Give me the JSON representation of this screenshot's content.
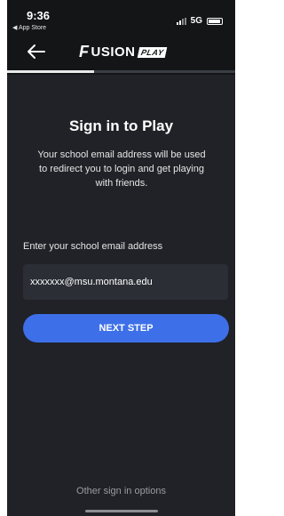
{
  "status_bar": {
    "time": "9:36",
    "back_app": "◀ App Store",
    "network": "5G"
  },
  "nav": {
    "back_icon": "arrow-left-icon",
    "logo_text": "USION",
    "logo_mark": "F",
    "logo_badge": "PLAY",
    "progress": 0.38
  },
  "main": {
    "title": "Sign in to Play",
    "description": "Your school email address will be used to redirect you to login and get playing with friends.",
    "field_label": "Enter your school email address",
    "email_value": "xxxxxxx@msu.montana.edu",
    "next_button": "NEXT STEP"
  },
  "footer": {
    "other_options": "Other sign in options"
  },
  "colors": {
    "background": "#202227",
    "header": "#131517",
    "accent": "#3d6fe8",
    "input": "#2b2e35"
  }
}
